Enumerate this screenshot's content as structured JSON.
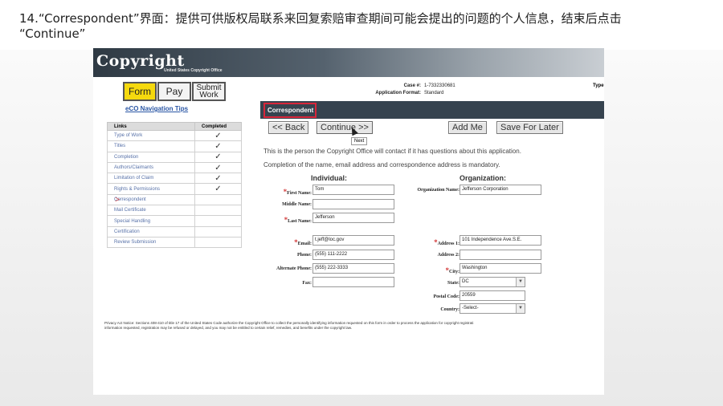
{
  "caption": {
    "line1": "14.“Correspondent”界面：提供可供版权局联系来回复索赔审查期间可能会提出的问题的个人信息，结束后点击",
    "line2": "“Continue”"
  },
  "header": {
    "logo_text": "Copyright",
    "logo_subtext": "United States Copyright Office"
  },
  "top_nav": {
    "form_label": "Form",
    "pay_label": "Pay",
    "submit_label_line1": "Submit",
    "submit_label_line2": "Work",
    "nav_tips_label": "eCO Navigation Tips"
  },
  "case_info": {
    "case_label": "Case #:",
    "case_value": "1-7332330681",
    "format_label": "Application Format:",
    "format_value": "Standard",
    "type_label": "Type"
  },
  "links_table": {
    "headers": [
      "Links",
      "Completed"
    ],
    "rows": [
      {
        "label": "Type of Work",
        "completed": "✓"
      },
      {
        "label": "Titles",
        "completed": "✓"
      },
      {
        "label": "Completion",
        "completed": "✓"
      },
      {
        "label": "Authors/Claimants",
        "completed": "✓"
      },
      {
        "label": "Limitation of Claim",
        "completed": "✓"
      },
      {
        "label": "Rights & Permissions",
        "completed": "✓"
      },
      {
        "label": "Correspondent",
        "completed": ""
      },
      {
        "label": "Mail Certificate",
        "completed": ""
      },
      {
        "label": "Special Handling",
        "completed": ""
      },
      {
        "label": "Certification",
        "completed": ""
      },
      {
        "label": "Review Submission",
        "completed": ""
      }
    ],
    "current_marker": ">"
  },
  "section": {
    "title": "Correspondent"
  },
  "actions": {
    "back_label": "<< Back",
    "continue_label": "Continue >>",
    "add_me_label": "Add Me",
    "save_later_label": "Save For Later",
    "tooltip": "Next"
  },
  "info": {
    "line1": "This is the person the Copyright Office will contact if it has questions about this application.",
    "line2": "Completion of the name, email address and correspondence address is mandatory."
  },
  "individual": {
    "heading": "Individual:",
    "first_name_label": "First Name:",
    "first_name_value": "Tom",
    "middle_name_label": "Middle Name:",
    "middle_name_value": "",
    "last_name_label": "Last Name:",
    "last_name_value": "Jefferson",
    "email_label": "Email:",
    "email_value": "t.jeff@loc.gov",
    "phone_label": "Phone:",
    "phone_value": "(555) 111-2222",
    "alt_phone_label": "Alternate Phone:",
    "alt_phone_value": "(555) 222-3333",
    "fax_label": "Fax:",
    "fax_value": ""
  },
  "organization": {
    "heading": "Organization:",
    "org_name_label": "Organization Name:",
    "org_name_value": "Jefferson Corporation",
    "address1_label": "Address 1:",
    "address1_value": "101 Independence Ave.S.E.",
    "address2_label": "Address 2:",
    "address2_value": "",
    "city_label": "City:",
    "city_value": "Washington",
    "state_label": "State:",
    "state_value": "DC",
    "postal_label": "Postal Code:",
    "postal_value": "20559",
    "country_label": "Country:",
    "country_value": "-Select-"
  },
  "privacy": {
    "line1": "Privacy Act Notice: Sections 408-410 of title 17 of the United States Code authorize the Copyright Office to collect the personally identifying information requested on this form in order to process the application for copyright registrati",
    "line2": "information requested, registration may be refused or delayed, and you may not be entitled to certain relief, remedies, and benefits under the copyright law."
  },
  "icons": {
    "check": "check-icon",
    "required": "asterisk-icon",
    "dropdown": "chevron-down-icon"
  },
  "colors": {
    "form_tab": "#f5d90e",
    "section_bar": "#36434f",
    "highlight": "#d8263a",
    "link": "#2a56a5"
  }
}
